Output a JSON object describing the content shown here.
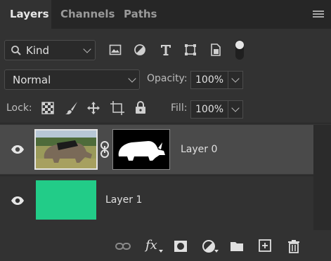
{
  "tabs": [
    {
      "label": "Layers",
      "active": true
    },
    {
      "label": "Channels",
      "active": false
    },
    {
      "label": "Paths",
      "active": false
    }
  ],
  "filter": {
    "kind_label": "Kind",
    "icons": [
      "image-filter-icon",
      "adjustment-filter-icon",
      "type-filter-icon",
      "shape-filter-icon",
      "smart-object-filter-icon",
      "filter-toggle-icon"
    ]
  },
  "blend": {
    "mode": "Normal",
    "opacity_label": "Opacity:",
    "opacity_value": "100%"
  },
  "lock": {
    "label": "Lock:",
    "icons": [
      "lock-transparent-pixels-icon",
      "lock-image-pixels-icon",
      "lock-position-icon",
      "lock-artboard-icon",
      "lock-all-icon"
    ],
    "fill_label": "Fill:",
    "fill_value": "100%"
  },
  "layers": [
    {
      "name": "Layer 0",
      "selected": true,
      "visible": true,
      "has_mask": true
    },
    {
      "name": "Layer 1",
      "selected": false,
      "visible": true,
      "fill_color": "#22cc88"
    }
  ],
  "bottom_icons": [
    "link-layers-icon",
    "fx-icon",
    "add-mask-icon",
    "adjustment-layer-icon",
    "new-group-icon",
    "new-layer-icon",
    "delete-layer-icon"
  ],
  "bottom_fx_label": "fx",
  "colors": {
    "accent_green": "#22cc88",
    "panel_bg": "#323232",
    "selected_row": "#4a4a4a"
  }
}
